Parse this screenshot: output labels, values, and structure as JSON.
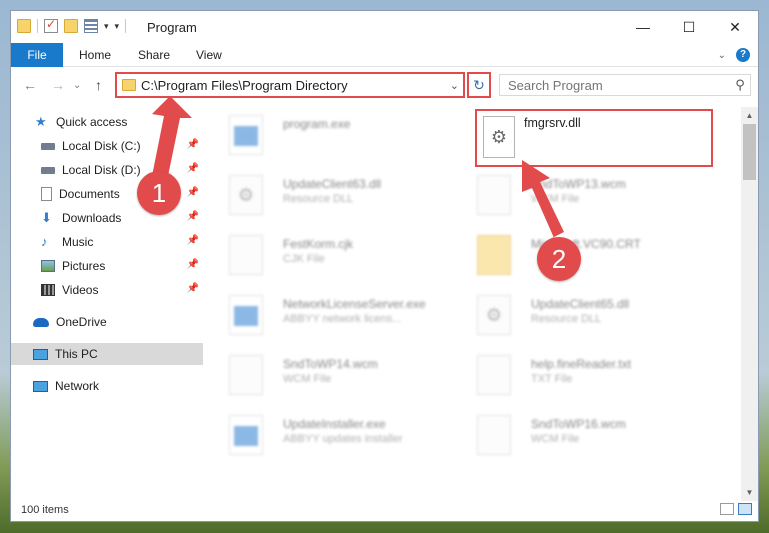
{
  "window": {
    "title": "Program",
    "minimize_label": "—",
    "maximize_label": "☐",
    "close_label": "✕"
  },
  "qat": {
    "dropdown_glyph": "▾"
  },
  "ribbon": {
    "tabs": [
      {
        "label": "File"
      },
      {
        "label": "Home"
      },
      {
        "label": "Share"
      },
      {
        "label": "View"
      }
    ],
    "collapse_glyph": "⌄",
    "help_glyph": "?"
  },
  "nav": {
    "back_glyph": "←",
    "forward_glyph": "→",
    "up_glyph": "↑",
    "dropdown_glyph": "⌄",
    "refresh_glyph": "↻",
    "address": "C:\\Program Files\\Program Directory",
    "search_placeholder": "Search Program",
    "search_glyph": "⚲"
  },
  "sidebar": {
    "items": [
      {
        "label": "Quick access",
        "icon": "star-icon",
        "pinned": false
      },
      {
        "label": "Local Disk (C:)",
        "icon": "disk-icon",
        "pinned": true
      },
      {
        "label": "Local Disk (D:)",
        "icon": "disk-icon",
        "pinned": true
      },
      {
        "label": "Documents",
        "icon": "documents-icon",
        "pinned": true
      },
      {
        "label": "Downloads",
        "icon": "download-icon",
        "pinned": true
      },
      {
        "label": "Music",
        "icon": "music-icon",
        "pinned": true
      },
      {
        "label": "Pictures",
        "icon": "pictures-icon",
        "pinned": true
      },
      {
        "label": "Videos",
        "icon": "videos-icon",
        "pinned": true
      },
      {
        "label": "OneDrive",
        "icon": "cloud-icon",
        "pinned": false
      },
      {
        "label": "This PC",
        "icon": "computer-icon",
        "pinned": false
      },
      {
        "label": "Network",
        "icon": "network-icon",
        "pinned": false
      }
    ],
    "pin_glyph": "📌",
    "star_glyph": "★",
    "download_glyph": "⬇",
    "music_glyph": "♪"
  },
  "files": {
    "highlighted": {
      "name": "fmgrsrv.dll",
      "icon": "gear-icon"
    },
    "items": [
      {
        "name": "program.exe",
        "type": "",
        "icon": "app-icon"
      },
      {
        "name": "UpdateClient63.dll",
        "type": "Resource DLL",
        "icon": "gear-icon"
      },
      {
        "name": "SndToWP13.wcm",
        "type": "WCM File",
        "icon": "file-icon"
      },
      {
        "name": "FestKorm.cjk",
        "type": "CJK File",
        "icon": "file-icon"
      },
      {
        "name": "Microsoft.VC90.CRT",
        "type": "",
        "icon": "folder-icon"
      },
      {
        "name": "NetworkLicenseServer.exe",
        "type": "ABBYY network licens...",
        "icon": "app-icon"
      },
      {
        "name": "UpdateClient65.dll",
        "type": "Resource DLL",
        "icon": "gear-icon"
      },
      {
        "name": "SndToWP14.wcm",
        "type": "WCM File",
        "icon": "file-icon"
      },
      {
        "name": "help.fineReader.txt",
        "type": "TXT File",
        "icon": "file-icon"
      },
      {
        "name": "UpdateInstaller.exe",
        "type": "ABBYY updates installer",
        "icon": "app-icon"
      },
      {
        "name": "SndToWP16.wcm",
        "type": "WCM File",
        "icon": "file-icon"
      }
    ],
    "gear_glyph": "⚙"
  },
  "scroll": {
    "up_glyph": "▲",
    "down_glyph": "▼"
  },
  "status": {
    "item_count": "100 items"
  },
  "annotations": {
    "step1": "1",
    "step2": "2"
  },
  "colors": {
    "accent": "#1979ca",
    "annotation_red": "#e24b4b"
  }
}
